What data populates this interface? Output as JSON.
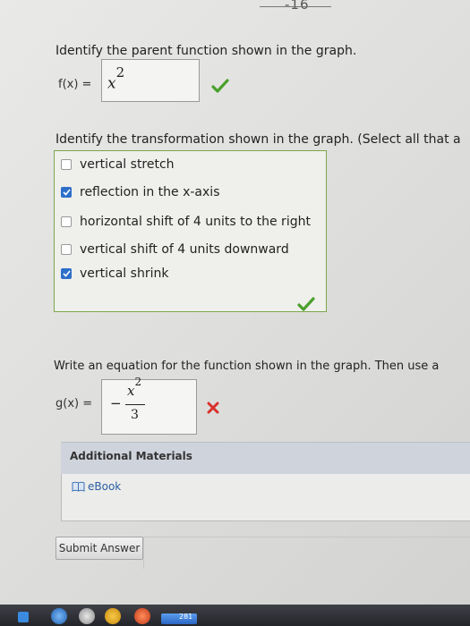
{
  "page_number": "-16",
  "question1": {
    "prompt": "Identify the parent function shown in the graph.",
    "label": "f(x) =",
    "answer_base": "x",
    "answer_exp": "2",
    "status": "correct"
  },
  "question2": {
    "prompt": "Identify the transformation shown in the graph. (Select all that a",
    "options": [
      {
        "label": "vertical stretch",
        "checked": false
      },
      {
        "label": "reflection in the x-axis",
        "checked": true
      },
      {
        "label": "horizontal shift of 4 units to the right",
        "checked": false
      },
      {
        "label": "vertical shift of 4 units downward",
        "checked": false
      },
      {
        "label": "vertical shrink",
        "checked": true
      }
    ],
    "status": "correct"
  },
  "question3": {
    "prompt": "Write an equation for the function shown in the graph. Then use a",
    "label": "g(x) =",
    "sign": "−",
    "numerator_base": "x",
    "numerator_exp": "2",
    "denominator": "3",
    "status": "incorrect"
  },
  "additional_materials": {
    "title": "Additional Materials",
    "ebook_label": "eBook"
  },
  "submit_label": "Submit Answer",
  "taskbar": {
    "badge": "281"
  },
  "colors": {
    "correct": "#4aa02c",
    "incorrect": "#d9302c",
    "checkbox": "#2d6fc9"
  }
}
